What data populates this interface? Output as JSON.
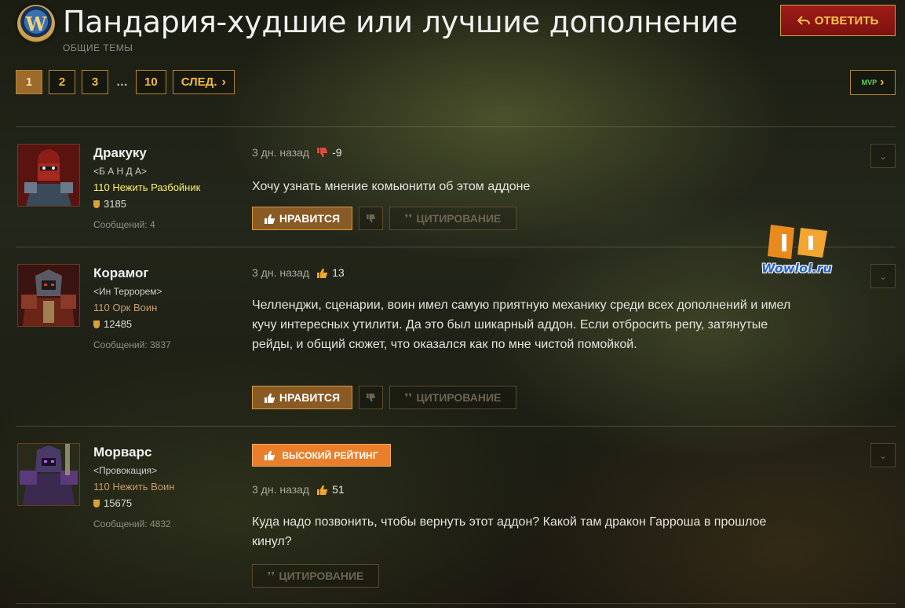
{
  "header": {
    "logo_letter": "W",
    "title": "Пандария-худшие или лучшие дополнение",
    "category": "ОБЩИЕ ТЕМЫ",
    "reply_label": "ОТВЕТИТЬ"
  },
  "pagination": {
    "pages": [
      "1",
      "2",
      "3"
    ],
    "ellipsis": "…",
    "last_page": "10",
    "next_label": "СЛЕД.",
    "current": "1"
  },
  "mvp_label": "MVP",
  "posts": [
    {
      "username": "Дракуку",
      "guild": "<Б А Н Д А>",
      "char_info": "110 Нежить Разбойник",
      "char_color": "#fff468",
      "achievements": "3185",
      "post_count": "Сообщений: 4",
      "time": "3 дн. назад",
      "vote_type": "down",
      "votes": "-9",
      "text": "Хочу узнать мнение комьюнити об этом аддоне",
      "like_label": "НРАВИТСЯ",
      "quote_label": "ЦИТИРОВАНИЕ"
    },
    {
      "username": "Корамог",
      "guild": "<Ин Террорем>",
      "char_info": "110 Орк Воин",
      "char_color": "#c79c6e",
      "achievements": "12485",
      "post_count": "Сообщений: 3837",
      "time": "3 дн. назад",
      "vote_type": "up",
      "votes": "13",
      "text": "Челленджи, сценарии, воин имел самую приятную механику среди всех дополнений и имел кучу интересных утилити. Да это был шикарный аддон. Если отбросить репу, затянутые рейды, и общий сюжет, что оказался как по мне чистой помойкой.",
      "like_label": "НРАВИТСЯ",
      "quote_label": "ЦИТИРОВАНИЕ"
    },
    {
      "username": "Морварс",
      "guild": "<Провокация>",
      "char_info": "110 Нежить Воин",
      "char_color": "#c79c6e",
      "achievements": "15675",
      "post_count": "Сообщений: 4832",
      "badge": "ВЫСОКИЙ РЕЙТИНГ",
      "time": "3 дн. назад",
      "vote_type": "up",
      "votes": "51",
      "text": "Куда надо позвонить, чтобы вернуть этот аддон? Какой там дракон Гарроша в прошлое кинул?",
      "quote_label": "ЦИТИРОВАНИЕ"
    }
  ],
  "watermark": "Wowlol.ru",
  "colors": {
    "accent_gold": "#f3b940",
    "reply_red": "#a01b18",
    "high_rating_orange": "#e97f2b",
    "like_brown": "#8a5a25"
  }
}
